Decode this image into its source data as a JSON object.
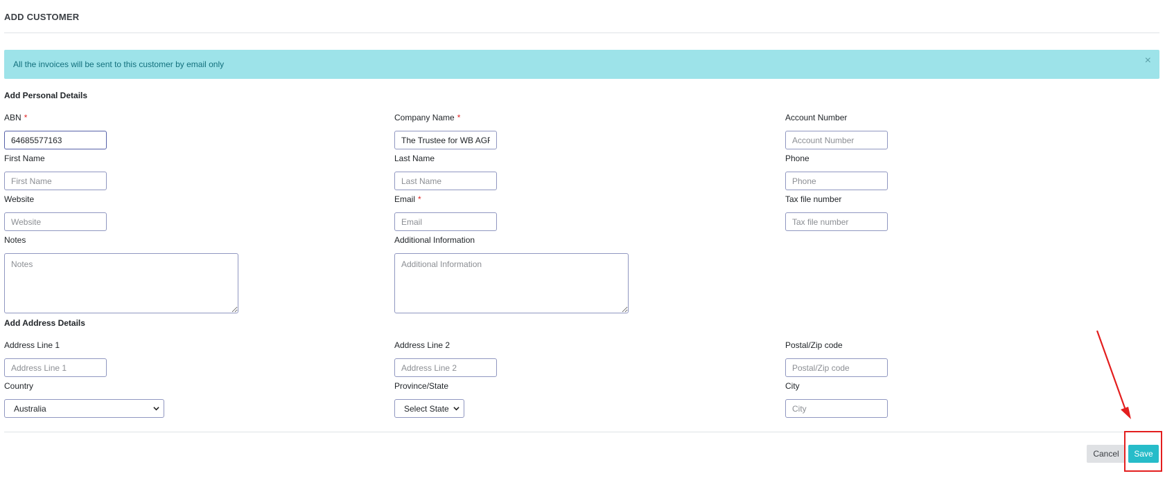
{
  "page": {
    "title": "ADD CUSTOMER"
  },
  "alert": {
    "message": "All the invoices will be sent to this customer by email only",
    "close_glyph": "×"
  },
  "personal": {
    "heading": "Add Personal Details",
    "abn": {
      "label": "ABN",
      "required_mark": "*",
      "value": "64685577163"
    },
    "company_name": {
      "label": "Company Name",
      "required_mark": "*",
      "value": "The Trustee for WB AGR"
    },
    "account_number": {
      "label": "Account Number",
      "placeholder": "Account Number"
    },
    "first_name": {
      "label": "First Name",
      "placeholder": "First Name"
    },
    "last_name": {
      "label": "Last Name",
      "placeholder": "Last Name"
    },
    "phone": {
      "label": "Phone",
      "placeholder": "Phone"
    },
    "website": {
      "label": "Website",
      "placeholder": "Website"
    },
    "email": {
      "label": "Email",
      "required_mark": "*",
      "placeholder": "Email"
    },
    "tax_file_number": {
      "label": "Tax file number",
      "placeholder": "Tax file number"
    },
    "notes": {
      "label": "Notes",
      "placeholder": "Notes"
    },
    "additional_info": {
      "label": "Additional Information",
      "placeholder": "Additional Information"
    }
  },
  "address": {
    "heading": "Add Address Details",
    "line1": {
      "label": "Address Line 1",
      "placeholder": "Address Line 1"
    },
    "line2": {
      "label": "Address Line 2",
      "placeholder": "Address Line 2"
    },
    "postal": {
      "label": "Postal/Zip code",
      "placeholder": "Postal/Zip code"
    },
    "country": {
      "label": "Country",
      "selected": "Australia"
    },
    "province": {
      "label": "Province/State",
      "selected": "Select State"
    },
    "city": {
      "label": "City",
      "placeholder": "City"
    }
  },
  "actions": {
    "cancel_label": "Cancel",
    "save_label": "Save"
  },
  "colors": {
    "alert_bg": "#9de3e9",
    "alert_text": "#13707d",
    "save_bg": "#27bcc9",
    "required": "#e02424",
    "annotation": "#e31e1e"
  }
}
